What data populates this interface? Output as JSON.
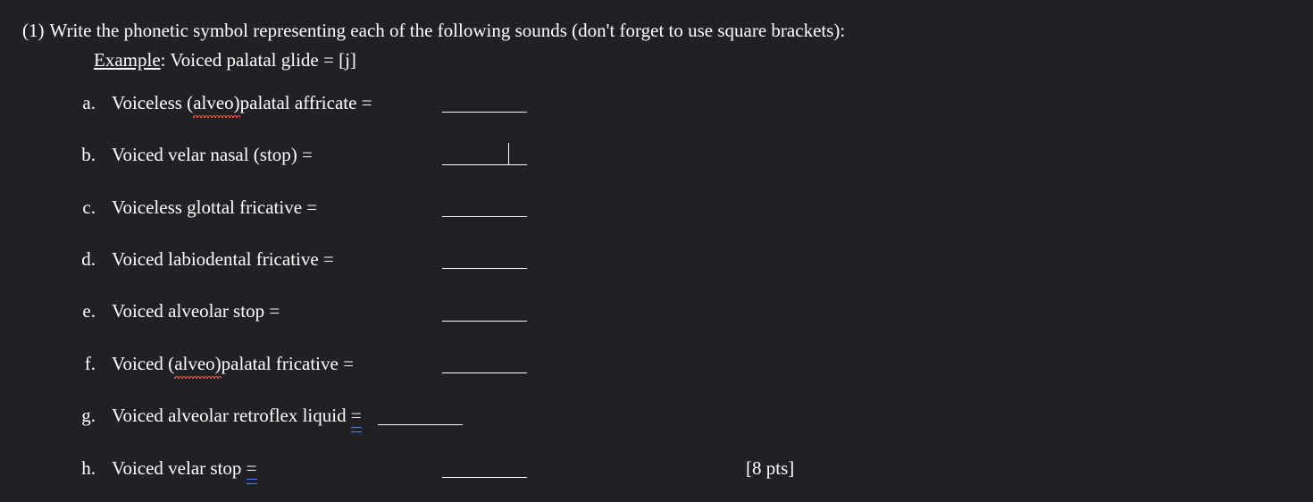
{
  "question_number": "(1)",
  "question_text": "Write the phonetic symbol representing each of the following sounds (don't forget to use square brackets):",
  "example_label": "Example",
  "example_text": ":   Voiced palatal glide = [j]",
  "items": {
    "a": {
      "letter": "a.",
      "pre": "Voiceless (",
      "squiggle": "alveo)",
      "post": "palatal affricate ="
    },
    "b": {
      "letter": "b.",
      "text": "Voiced velar nasal (stop) ="
    },
    "c": {
      "letter": "c.",
      "text": "Voiceless glottal fricative ="
    },
    "d": {
      "letter": "d.",
      "text": "Voiced labiodental fricative ="
    },
    "e": {
      "letter": "e.",
      "text": "Voiced alveolar stop ="
    },
    "f": {
      "letter": "f.",
      "pre": "Voiced (",
      "squiggle": "alveo)",
      "post": "palatal fricative ="
    },
    "g": {
      "letter": "g.",
      "text": "Voiced alveolar retroflex liquid ",
      "equals": "="
    },
    "h": {
      "letter": "h.",
      "text": "Voiced velar stop ",
      "equals": "="
    }
  },
  "points": "[8 pts]"
}
